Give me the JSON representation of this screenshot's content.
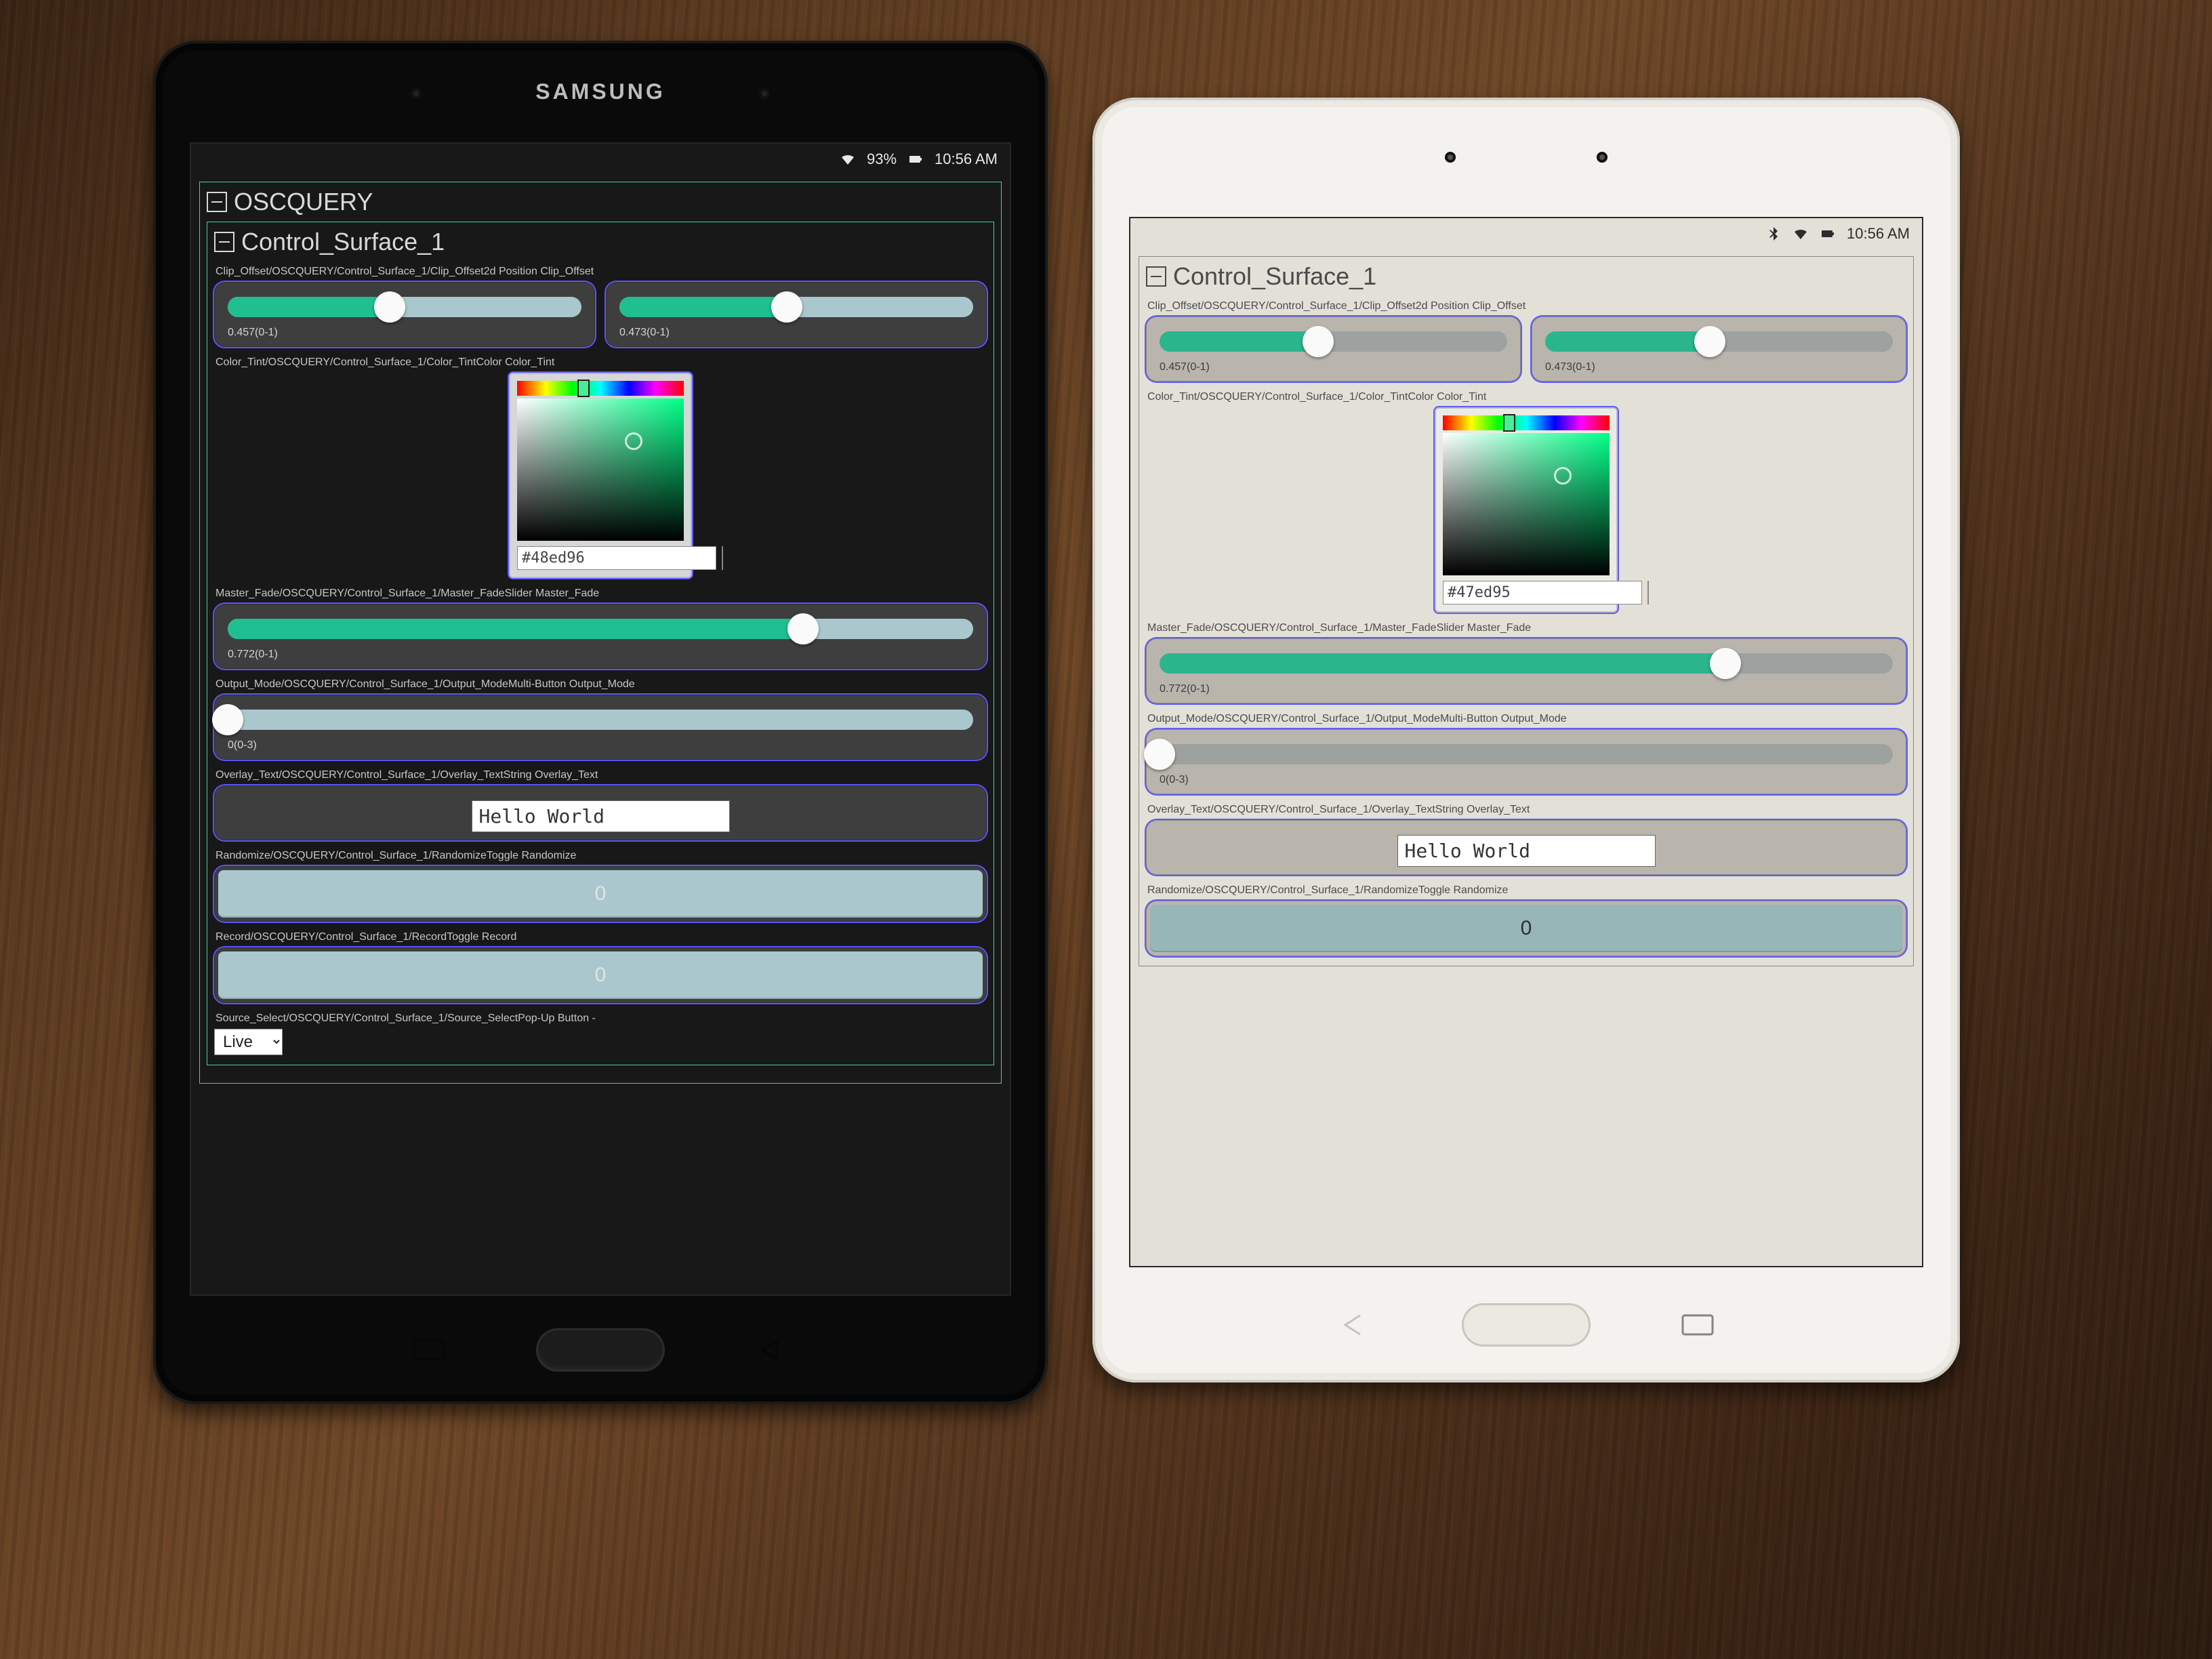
{
  "left": {
    "status": {
      "battery_pct": "93%",
      "time": "10:56 AM"
    },
    "root_title": "OSCQUERY",
    "surface_title": "Control_Surface_1",
    "clip_offset": {
      "label": "Clip_Offset/OSCQUERY/Control_Surface_1/Clip_Offset2d Position Clip_Offset",
      "x": {
        "caption": "0.457(0-1)",
        "frac": 0.457
      },
      "y": {
        "caption": "0.473(0-1)",
        "frac": 0.473
      }
    },
    "color_tint": {
      "label": "Color_Tint/OSCQUERY/Control_Surface_1/Color_TintColor Color_Tint",
      "hex": "#48ed96",
      "hue_frac": 0.4,
      "sv_x": 0.7,
      "sv_y": 0.3,
      "base": "#00ff88"
    },
    "master_fade": {
      "label": "Master_Fade/OSCQUERY/Control_Surface_1/Master_FadeSlider Master_Fade",
      "caption": "0.772(0-1)",
      "frac": 0.772
    },
    "output_mode": {
      "label": "Output_Mode/OSCQUERY/Control_Surface_1/Output_ModeMulti-Button Output_Mode",
      "caption": "0(0-3)",
      "frac": 0.0
    },
    "overlay_text": {
      "label": "Overlay_Text/OSCQUERY/Control_Surface_1/Overlay_TextString Overlay_Text",
      "value": "Hello World"
    },
    "randomize": {
      "label": "Randomize/OSCQUERY/Control_Surface_1/RandomizeToggle Randomize",
      "value": "0"
    },
    "record": {
      "label": "Record/OSCQUERY/Control_Surface_1/RecordToggle Record",
      "value": "0"
    },
    "source_select": {
      "label": "Source_Select/OSCQUERY/Control_Surface_1/Source_SelectPop-Up Button -",
      "value": "Live"
    }
  },
  "right": {
    "status": {
      "time": "10:56 AM"
    },
    "surface_title": "Control_Surface_1",
    "clip_offset": {
      "label": "Clip_Offset/OSCQUERY/Control_Surface_1/Clip_Offset2d Position Clip_Offset",
      "x": {
        "caption": "0.457(0-1)",
        "frac": 0.457
      },
      "y": {
        "caption": "0.473(0-1)",
        "frac": 0.473
      }
    },
    "color_tint": {
      "label": "Color_Tint/OSCQUERY/Control_Surface_1/Color_TintColor Color_Tint",
      "hex": "#47ed95",
      "hue_frac": 0.4,
      "sv_x": 0.72,
      "sv_y": 0.3,
      "base": "#00ff88"
    },
    "master_fade": {
      "label": "Master_Fade/OSCQUERY/Control_Surface_1/Master_FadeSlider Master_Fade",
      "caption": "0.772(0-1)",
      "frac": 0.772
    },
    "output_mode": {
      "label": "Output_Mode/OSCQUERY/Control_Surface_1/Output_ModeMulti-Button Output_Mode",
      "caption": "0(0-3)",
      "frac": 0.0
    },
    "overlay_text": {
      "label": "Overlay_Text/OSCQUERY/Control_Surface_1/Overlay_TextString Overlay_Text",
      "value": "Hello World"
    },
    "randomize": {
      "label": "Randomize/OSCQUERY/Control_Surface_1/RandomizeToggle Randomize",
      "value": "0"
    }
  },
  "hw": {
    "brand": "SAMSUNG"
  }
}
